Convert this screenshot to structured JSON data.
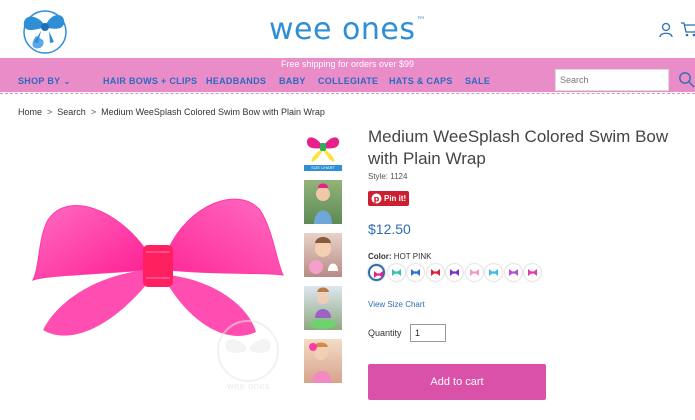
{
  "header": {
    "brand": "wee ones",
    "brand_tm": "™",
    "logo_icon": "wee-ones-bow-logo",
    "account_icon": "user-icon",
    "cart_icon": "cart-icon"
  },
  "promo": {
    "text": "Free shipping for orders over $99"
  },
  "nav": {
    "items": [
      {
        "label": "SHOP BY"
      },
      {
        "label": "HAIR BOWS + CLIPS"
      },
      {
        "label": "HEADBANDS"
      },
      {
        "label": "BABY"
      },
      {
        "label": "COLLEGIATE"
      },
      {
        "label": "HATS & CAPS"
      },
      {
        "label": "SALE"
      }
    ],
    "search_placeholder": "Search"
  },
  "breadcrumb": {
    "items": [
      "Home",
      "Search",
      "Medium WeeSplash Colored Swim Bow with Plain Wrap"
    ],
    "separator": ">"
  },
  "gallery": {
    "size_chart_tag": "SIZE CHART",
    "watermark": "wee ones"
  },
  "product": {
    "title": "Medium WeeSplash Colored Swim Bow with Plain Wrap",
    "style": "Style: 1124",
    "pin_label": "Pin it!",
    "price": "$12.50",
    "color_label": "Color:",
    "color_value": "HOT PINK",
    "swatches": [
      "#e8208a",
      "#2fc4b0",
      "#2f6fd6",
      "#e0203a",
      "#7a2fd0",
      "#f49ac6",
      "#3fbde8",
      "#b04fd9",
      "#e03aa8"
    ],
    "size_chart_link": "View Size Chart",
    "quantity_label": "Quantity",
    "quantity_value": "1",
    "add_to_cart": "Add to cart"
  },
  "colors": {
    "brand_blue": "#2f8fd6",
    "nav_pink": "#ea8cc8",
    "button_pink": "#d951a8",
    "price_blue": "#2f6db3"
  }
}
